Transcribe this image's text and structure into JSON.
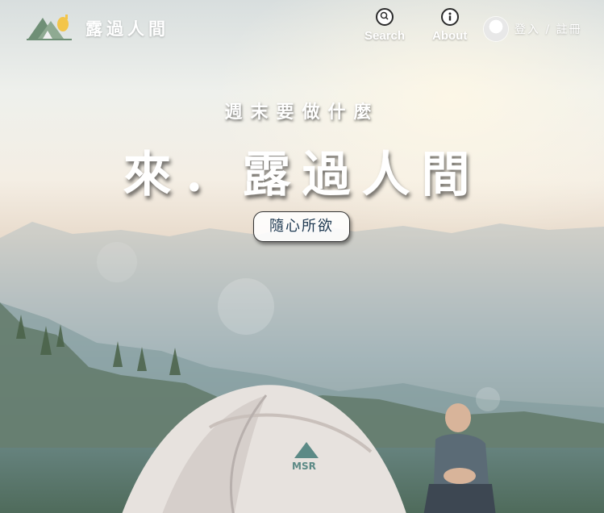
{
  "header": {
    "brand": "露過人間",
    "nav": {
      "search_label": "Search",
      "about_label": "About"
    },
    "login_label": "登入 / 註冊"
  },
  "hero": {
    "subtitle": "週末要做什麼",
    "headline": "來．露過人間",
    "cta_label": "隨心所欲",
    "tent_brand": "MSR"
  },
  "colors": {
    "text_on_image": "#ffffff",
    "cta_text": "#1f3a52",
    "logo_green": "#6f8f76",
    "logo_yellow": "#f3c54a"
  },
  "icons": {
    "logo": "tent-logo-icon",
    "search": "map-pin-search-icon",
    "about": "info-icon",
    "avatar": "user-avatar-icon"
  }
}
